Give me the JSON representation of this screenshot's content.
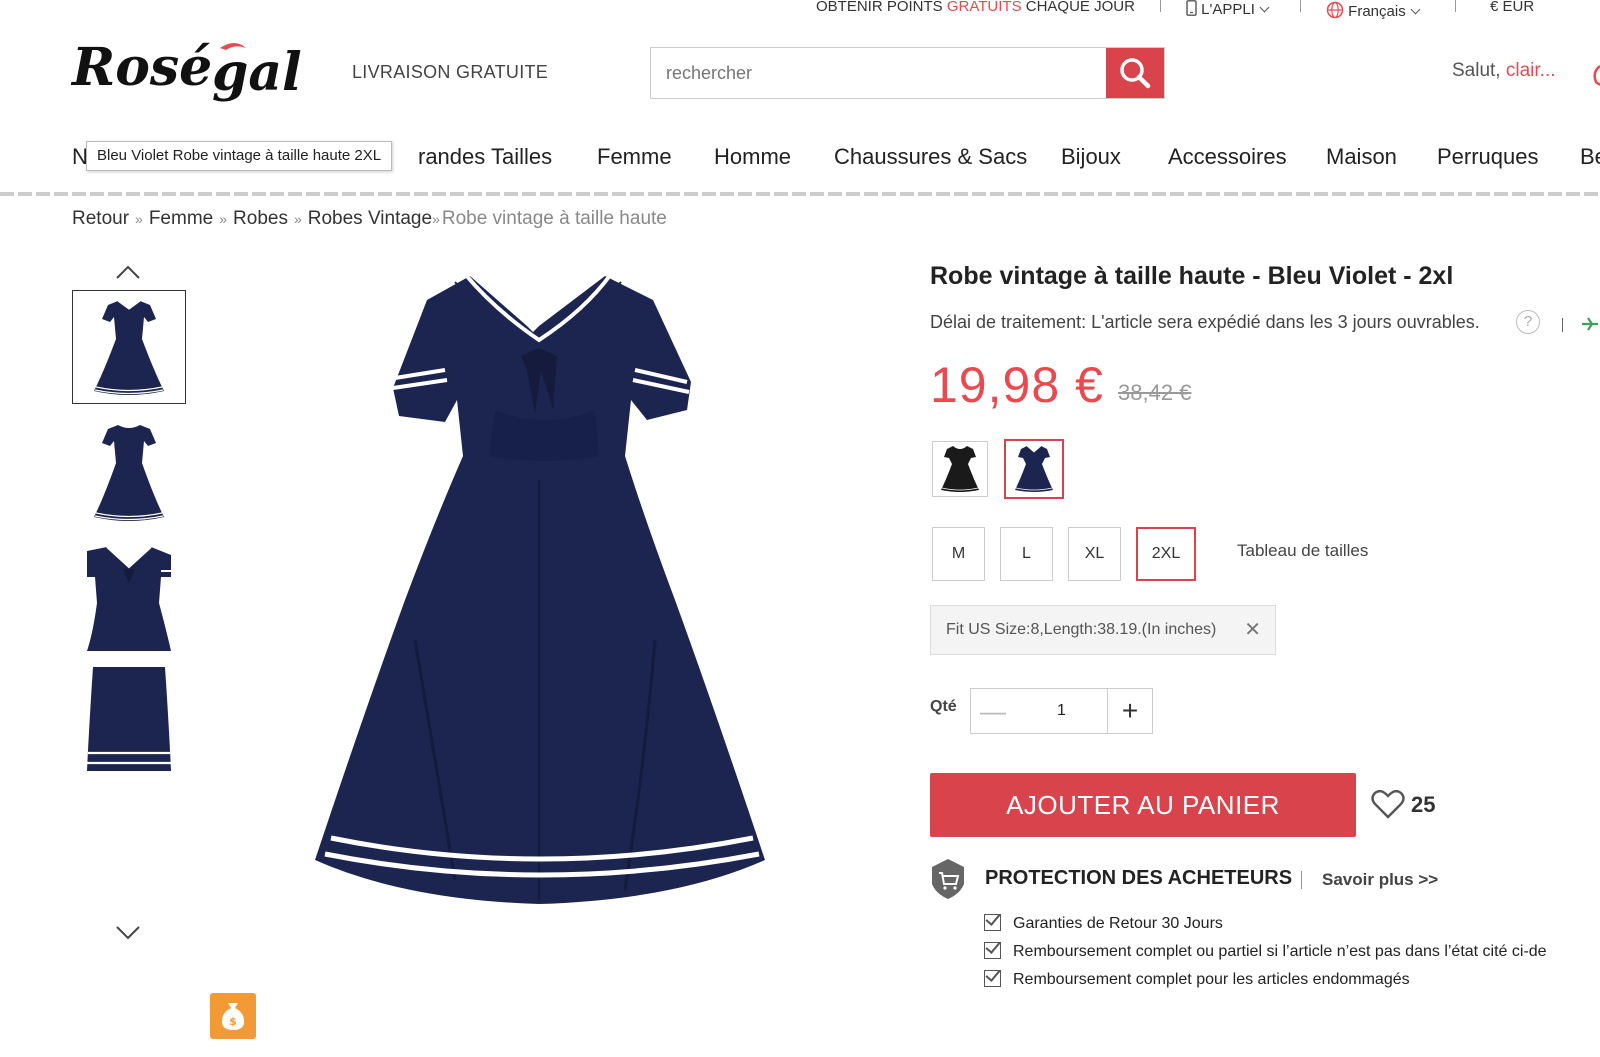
{
  "topbar": {
    "points_prefix": "OBTENIR POINTS",
    "points_highlight": "GRATUITS",
    "points_suffix": "CHAQUE JOUR",
    "app": "L'APPLI",
    "language": "Français",
    "currency": "€ EUR"
  },
  "header": {
    "logo_text": "Rosegal",
    "free_shipping": "LIVRAISON GRATUITE",
    "search_placeholder": "rechercher",
    "greeting_prefix": "Salut,",
    "greeting_user": "clair..."
  },
  "nav": {
    "first_letter": "N",
    "items": [
      "randes Tailles",
      "Femme",
      "Homme",
      "Chaussures & Sacs",
      "Bijoux",
      "Accessoires",
      "Maison",
      "Perruques",
      "Be"
    ],
    "tooltip": "Bleu Violet Robe vintage à taille haute 2XL"
  },
  "breadcrumb": {
    "items": [
      "Retour",
      "Femme",
      "Robes",
      "Robes Vintage"
    ],
    "separator": "»",
    "current": "Robe vintage à taille haute"
  },
  "product": {
    "title": "Robe vintage à taille haute - Bleu Violet - 2xl",
    "delay": "Délai de traitement: L'article sera expédié dans les 3 jours ouvrables.",
    "help": "?",
    "price": "19,98 €",
    "old_price": "38,42 €",
    "colors": [
      "black",
      "navy"
    ],
    "selected_color": "navy",
    "sizes": [
      "M",
      "L",
      "XL",
      "2XL"
    ],
    "selected_size": "2XL",
    "size_chart": "Tableau de tailles",
    "fit_info": "Fit US Size:8,Length:38.19.(In inches)",
    "fit_close": "✕",
    "qty_label": "Qté",
    "qty_minus": "—",
    "qty_value": "1",
    "qty_plus": "+",
    "add_to_cart": "AJOUTER AU PANIER",
    "favorites": "25"
  },
  "protection": {
    "title": "PROTECTION DES ACHETEURS",
    "learn_more": "Savoir plus >>",
    "items": [
      "Garanties de Retour 30 Jours",
      "Remboursement complet ou partiel si l’article n’est pas dans l’état cité ci-de",
      "Remboursement complet pour les articles endommagés"
    ]
  },
  "icons": {
    "search": "search-icon",
    "phone": "phone-icon",
    "globe": "globe-icon",
    "heart": "heart-icon",
    "cart_shield": "cart-shield-icon",
    "money_bag": "money-bag-icon",
    "plane": "plane-icon"
  },
  "colors": {
    "brand_red": "#d9434c",
    "price_red": "#e84a4f",
    "dress_navy": "#1c2550"
  }
}
